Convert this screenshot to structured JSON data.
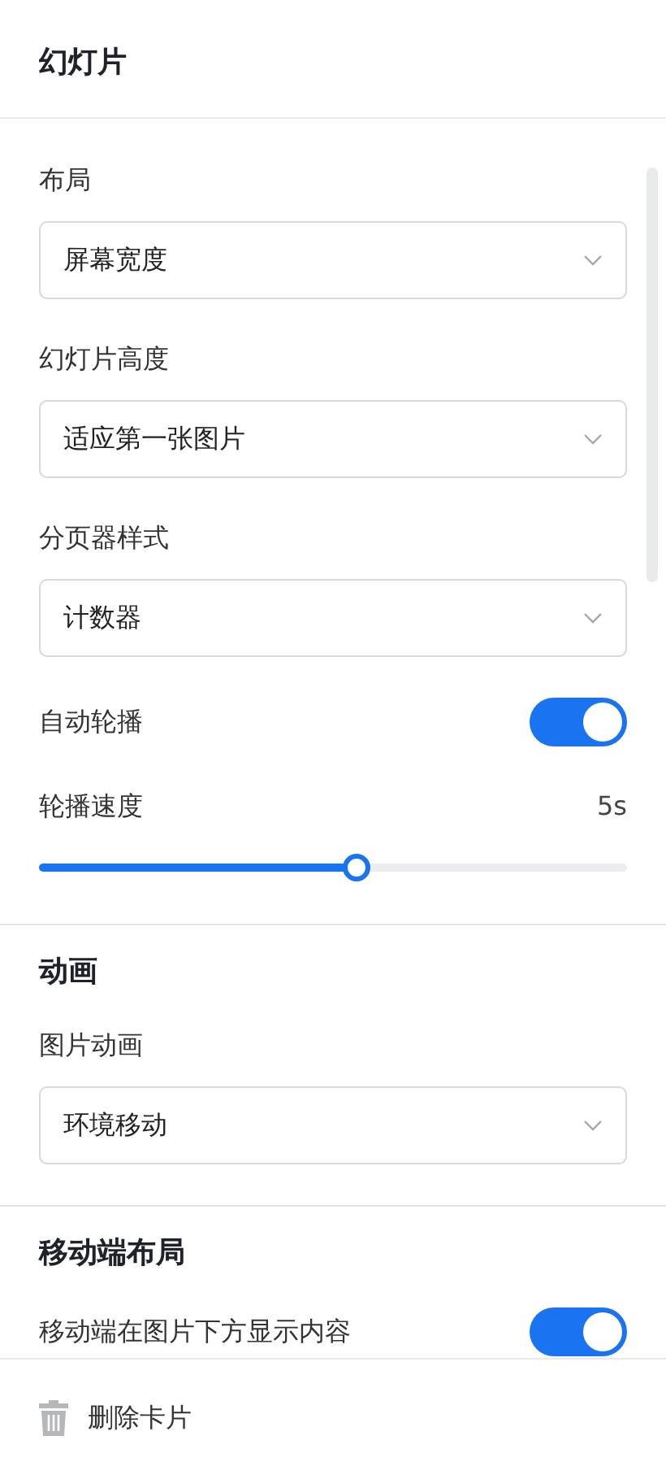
{
  "header": {
    "title": "幻灯片"
  },
  "sections": [
    {
      "fields": [
        {
          "kind": "select",
          "label": "布局",
          "value": "屏幕宽度"
        },
        {
          "kind": "select",
          "label": "幻灯片高度",
          "value": "适应第一张图片"
        },
        {
          "kind": "select",
          "label": "分页器样式",
          "value": "计数器"
        },
        {
          "kind": "toggle",
          "label": "自动轮播",
          "on": true
        },
        {
          "kind": "slider",
          "label": "轮播速度",
          "reading": "5s",
          "level": 0.54
        }
      ]
    },
    {
      "heading": "动画",
      "fields": [
        {
          "kind": "select",
          "label": "图片动画",
          "value": "环境移动"
        }
      ]
    },
    {
      "heading": "移动端布局",
      "fields": [
        {
          "kind": "toggle",
          "label": "移动端在图片下方显示内容",
          "on": true
        }
      ]
    }
  ],
  "footer": {
    "delete_button": "删除卡片"
  }
}
